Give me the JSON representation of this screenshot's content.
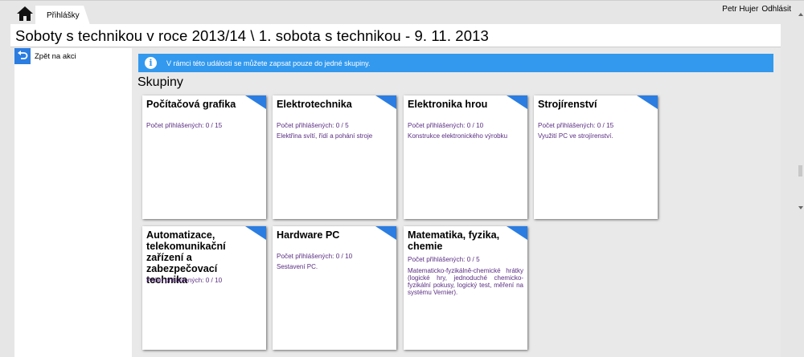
{
  "header": {
    "tab_label": "Přihlášky",
    "user_name": "Petr Hujer",
    "logout_label": "Odhlásit"
  },
  "page_title": "Soboty s technikou v roce 2013/14 \\ 1. sobota s technikou - 9. 11. 2013",
  "sidebar": {
    "back_label": "Zpět na akci"
  },
  "info": {
    "message": "V rámci této události se můžete zapsat pouze do jedné skupiny."
  },
  "section_title": "Skupiny",
  "groups": [
    {
      "title": "Počítačová grafika",
      "count": "Počet přihlášených: 0 / 15",
      "description": ""
    },
    {
      "title": "Elektrotechnika",
      "count": "Počet přihlášených: 0 / 5",
      "description": "Elektřina svítí, řídí a pohání stroje"
    },
    {
      "title": "Elektronika hrou",
      "count": "Počet přihlášených: 0 / 10",
      "description": "Konstrukce elektronického výrobku"
    },
    {
      "title": "Strojírenství",
      "count": "Počet přihlášených: 0 / 15",
      "description": "Využití PC ve strojírenství."
    },
    {
      "title": "Automatizace, telekomunikační zařízení a zabezpečovací technika",
      "count": "Počet přihlášených: 0 / 10",
      "description": ""
    },
    {
      "title": "Hardware PC",
      "count": "Počet přihlášených: 0 / 10",
      "description": "Sestavení PC."
    },
    {
      "title": "Matematika, fyzika, chemie",
      "count": "Počet přihlášených: 0 / 5",
      "description": "Matematicko-fyzikálně-chemické hrátky (logické hry, jednoduché chemicko-fyzikální pokusy, logický test, měření na systému Vernier)."
    }
  ],
  "colors": {
    "accent": "#2b7de1",
    "info_bar": "#3399ee",
    "card_text": "#5a2d82"
  },
  "icons": [
    "home-icon",
    "back-arrow-icon",
    "info-icon",
    "card-corner-marker"
  ]
}
